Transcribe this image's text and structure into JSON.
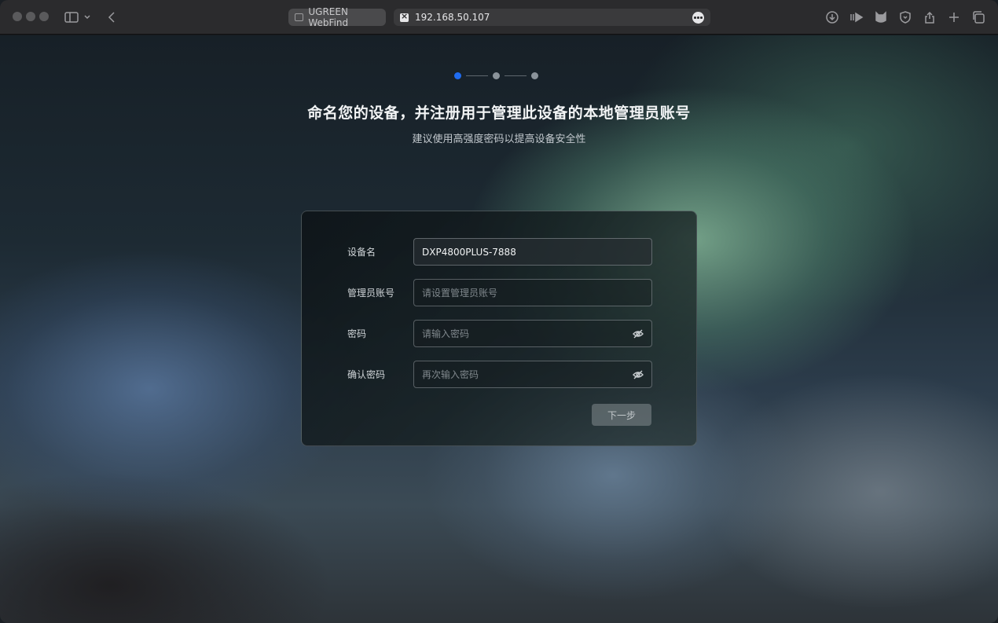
{
  "browser": {
    "tab_title": "UGREEN WebFind",
    "address": "192.168.50.107"
  },
  "setup": {
    "current_step": 1,
    "total_steps": 3,
    "title": "命名您的设备，并注册用于管理此设备的本地管理员账号",
    "subtitle": "建议使用高强度密码以提高设备安全性",
    "fields": [
      {
        "label": "设备名",
        "value": "DXP4800PLUS-7888",
        "placeholder": ""
      },
      {
        "label": "管理员账号",
        "value": "",
        "placeholder": "请设置管理员账号"
      },
      {
        "label": "密码",
        "value": "",
        "placeholder": "请输入密码"
      },
      {
        "label": "确认密码",
        "value": "",
        "placeholder": "再次输入密码"
      }
    ],
    "next_label": "下一步"
  },
  "colors": {
    "active_step": "#1f6cf0",
    "inactive_step": "#8a939a"
  }
}
